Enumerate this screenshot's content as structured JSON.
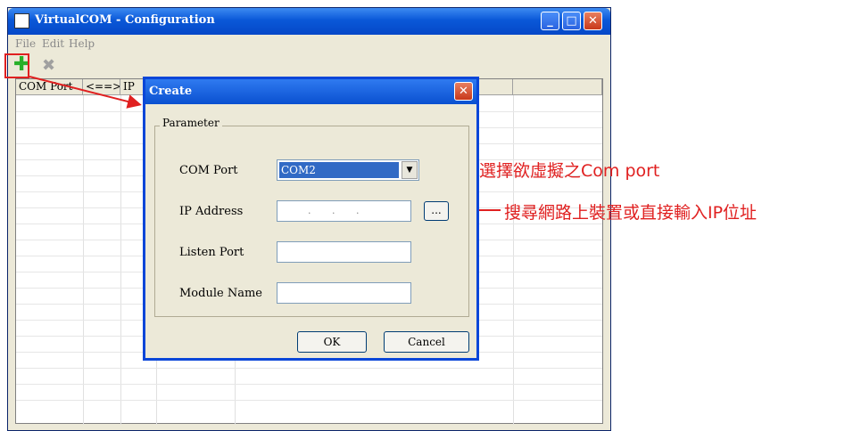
{
  "window": {
    "title": "VirtualCOM - Configuration",
    "minimize_label": "_",
    "maximize_label": "□",
    "close_label": "✕"
  },
  "menu": [
    "File",
    "Edit",
    "Help"
  ],
  "toolbar": {
    "add_icon": "plus-icon",
    "add_glyph": "✚",
    "delete_icon": "delete-x-icon",
    "delete_glyph": "✖"
  },
  "grid": {
    "columns": [
      "COM Port",
      "<==>",
      "IP"
    ]
  },
  "dialog": {
    "title": "Create",
    "close_label": "✕",
    "group_label": "Parameter",
    "com_port_label": "COM Port",
    "com_port_value": "COM2",
    "ip_label": "IP Address",
    "ip_value": ". . .",
    "browse_label": "...",
    "listen_label": "Listen Port",
    "listen_value": "",
    "module_label": "Module Name",
    "module_value": "",
    "ok_label": "OK",
    "cancel_label": "Cancel"
  },
  "annotations": {
    "com_port_note": "選擇欲虛擬之Com port",
    "ip_note": "搜尋網路上裝置或直接輸入IP位址"
  },
  "colors": {
    "annotation": "#e02020",
    "titlebar": "#0a58d8"
  }
}
